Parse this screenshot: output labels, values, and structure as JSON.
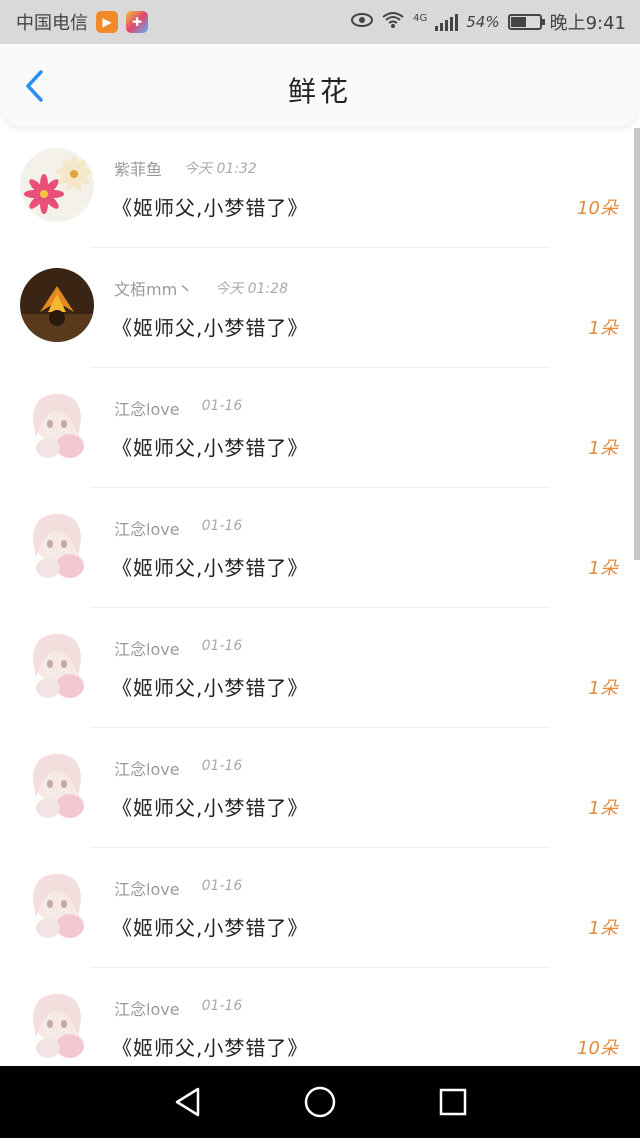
{
  "status_bar": {
    "carrier": "中国电信",
    "network": "4G",
    "battery_percent": "54%",
    "battery_level": 0.54,
    "time": "晚上9:41",
    "icons": [
      "app-badge-orange-icon",
      "app-badge-multicolor-icon",
      "eye-comfort-icon",
      "wifi-icon",
      "signal-icon",
      "battery-icon"
    ]
  },
  "header": {
    "title": "鲜花",
    "back_icon": "chevron-left-icon",
    "accent_color": "#2c8ff0"
  },
  "items": [
    {
      "user": "紫菲鱼",
      "time": "今天 01:32",
      "book": "《姬师父,小梦错了》",
      "amount": "10朵",
      "avatar": "flower"
    },
    {
      "user": "文栢mm丶",
      "time": "今天 01:28",
      "book": "《姬师父,小梦错了》",
      "amount": "1朵",
      "avatar": "autumn-leaf"
    },
    {
      "user": "江念love",
      "time": "01-16",
      "book": "《姬师父,小梦错了》",
      "amount": "1朵",
      "avatar": "anime-girl"
    },
    {
      "user": "江念love",
      "time": "01-16",
      "book": "《姬师父,小梦错了》",
      "amount": "1朵",
      "avatar": "anime-girl"
    },
    {
      "user": "江念love",
      "time": "01-16",
      "book": "《姬师父,小梦错了》",
      "amount": "1朵",
      "avatar": "anime-girl"
    },
    {
      "user": "江念love",
      "time": "01-16",
      "book": "《姬师父,小梦错了》",
      "amount": "1朵",
      "avatar": "anime-girl"
    },
    {
      "user": "江念love",
      "time": "01-16",
      "book": "《姬师父,小梦错了》",
      "amount": "1朵",
      "avatar": "anime-girl"
    },
    {
      "user": "江念love",
      "time": "01-16",
      "book": "《姬师父,小梦错了》",
      "amount": "10朵",
      "avatar": "anime-girl"
    }
  ],
  "nav_bar": {
    "icons": [
      "back-triangle-icon",
      "home-circle-icon",
      "recents-square-icon"
    ]
  }
}
